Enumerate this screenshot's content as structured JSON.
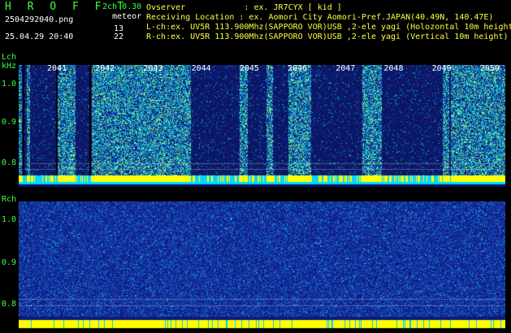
{
  "header": {
    "title": "H R O F F T",
    "mode": "2ch 0.30",
    "filename": "2504292040.png",
    "meteor_label": "meteor",
    "datetime": "25.04.29 20:40",
    "count_l": "13",
    "count_r": "22"
  },
  "info": {
    "observer": "Ovserver            : ex. JR7CYX [ kid ]",
    "location": "Receiving Location : ex. Aomori City Aomori-Pref.JAPAN(40.49N, 140.47E)",
    "lch": "L-ch:ex. UV5R 113.900Mhz(SAPPORO VOR)USB ,2-ele yagi (Holozontal 10m height)",
    "rch": "R-ch:ex. UV5R 113.900Mhz(SAPPORO VOR)USB ,2-ele yagi (Vertical 10m height)"
  },
  "lch_panel": {
    "label": "Lch",
    "unit": "kHz",
    "y_ticks": [
      "1.0",
      "0.9",
      "0.8"
    ],
    "x_ticks": [
      "2041",
      "2042",
      "2043",
      "2044",
      "2045",
      "2046",
      "2047",
      "2048",
      "2049",
      "2050"
    ]
  },
  "rch_panel": {
    "label": "Rch",
    "y_ticks": [
      "1.0",
      "0.9",
      "0.8"
    ]
  },
  "colors": {
    "label_green": "#3fff3f",
    "info_yellow": "#ffff3f",
    "band_yellow": "#ffff00",
    "band_cyan": "#00e5ff",
    "bg_dark_blue": "#0a1a6a"
  }
}
